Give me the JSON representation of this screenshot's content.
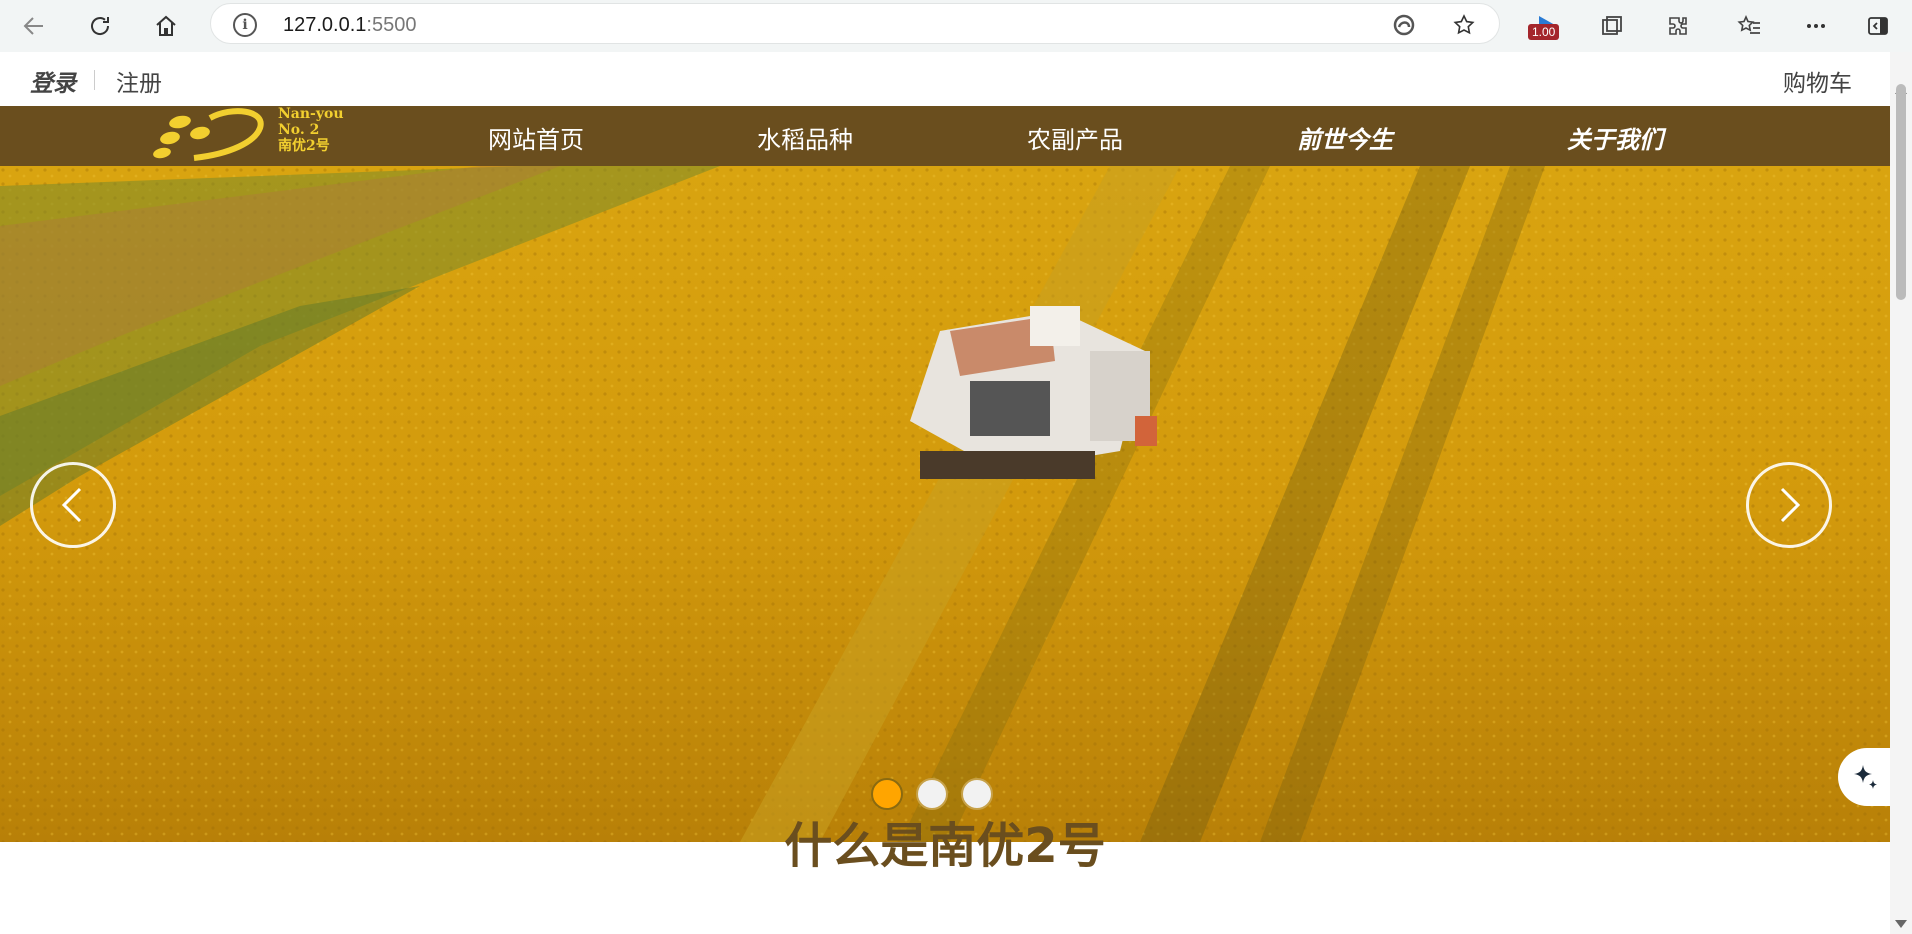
{
  "browser": {
    "url_host": "127.0.0.1",
    "url_port": ":5500",
    "extension_badge": "1.00"
  },
  "header": {
    "login": "登录",
    "register": "注册",
    "cart": "购物车"
  },
  "logo": {
    "line1": "Nan-you",
    "line2": "No. 2",
    "line3": "南优2号",
    "color": "#f2cf2f"
  },
  "nav": {
    "items": [
      {
        "label": "网站首页"
      },
      {
        "label": "水稻品种"
      },
      {
        "label": "农副产品"
      },
      {
        "label": "前世今生"
      },
      {
        "label": "关于我们"
      }
    ],
    "background": "#6a4e1e"
  },
  "carousel": {
    "slide_count": 3,
    "active_index": 0,
    "active_color": "#ffa500"
  },
  "section": {
    "title": "什么是南优2号"
  }
}
